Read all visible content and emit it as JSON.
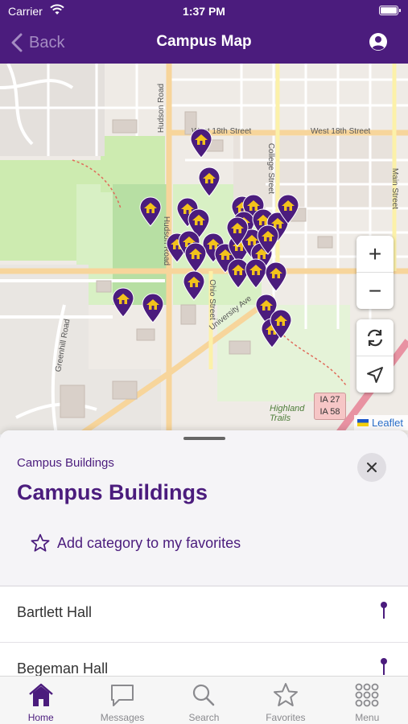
{
  "status_bar": {
    "carrier": "Carrier",
    "time": "1:37 PM"
  },
  "nav": {
    "back_label": "Back",
    "title": "Campus Map"
  },
  "map": {
    "zoom_in": "+",
    "zoom_out": "−",
    "attribution": "Leaflet",
    "streets": {
      "west_18th_a": "West 18th Street",
      "west_18th_b": "West 18th Street",
      "hudson_road": "Hudson Road",
      "hudson_road_2": "Hudson Road",
      "college_street": "College Street",
      "main_street": "Main Street",
      "ohio_street": "Ohio Street",
      "university_ave": "University Ave",
      "greenhill_road": "Greenhill Road",
      "highland_trails": "Highland Trails"
    },
    "highway_shield": {
      "line1": "IA 27",
      "line2": "IA 58"
    },
    "colors": {
      "pin": "#4b1c7d",
      "pin_icon": "#f3c21b"
    }
  },
  "sheet": {
    "subtitle": "Campus Buildings",
    "heading": "Campus Buildings",
    "favorite_label": "Add category to my favorites",
    "items": [
      {
        "name": "Bartlett Hall"
      },
      {
        "name": "Begeman Hall"
      }
    ]
  },
  "tabs": [
    {
      "label": "Home",
      "icon": "home-icon",
      "active": true
    },
    {
      "label": "Messages",
      "icon": "messages-icon",
      "active": false
    },
    {
      "label": "Search",
      "icon": "search-icon",
      "active": false
    },
    {
      "label": "Favorites",
      "icon": "star-icon",
      "active": false
    },
    {
      "label": "Menu",
      "icon": "grid-menu-icon",
      "active": false
    }
  ],
  "theme": {
    "primary": "#4b1c7d",
    "accent": "#f3c21b",
    "tab_inactive": "#8a8a8e"
  }
}
